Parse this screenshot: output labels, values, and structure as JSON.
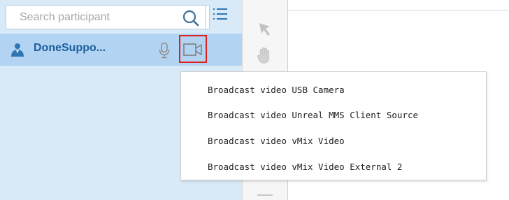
{
  "participants_panel": {
    "search": {
      "placeholder": "Search participant",
      "value": ""
    },
    "participants": [
      {
        "name": "DoneSuppo...",
        "icon": "user-icon",
        "microphone_icon": "microphone-icon",
        "camera_icon": "video-camera-icon"
      }
    ]
  },
  "tools": [
    {
      "icon": "pointer-arrow-icon"
    },
    {
      "icon": "hand-icon"
    }
  ],
  "broadcast_menu": {
    "items": [
      {
        "label": "Broadcast video USB Camera"
      },
      {
        "label": "Broadcast video Unreal MMS Client Source"
      },
      {
        "label": "Broadcast video vMix Video"
      },
      {
        "label": "Broadcast video vMix Video External 2"
      }
    ]
  },
  "colors": {
    "panel_background": "#d8eaf7",
    "selected_row": "#b2d4f2",
    "participant_name": "#1d5e9c",
    "highlight_border": "#e0201a"
  }
}
